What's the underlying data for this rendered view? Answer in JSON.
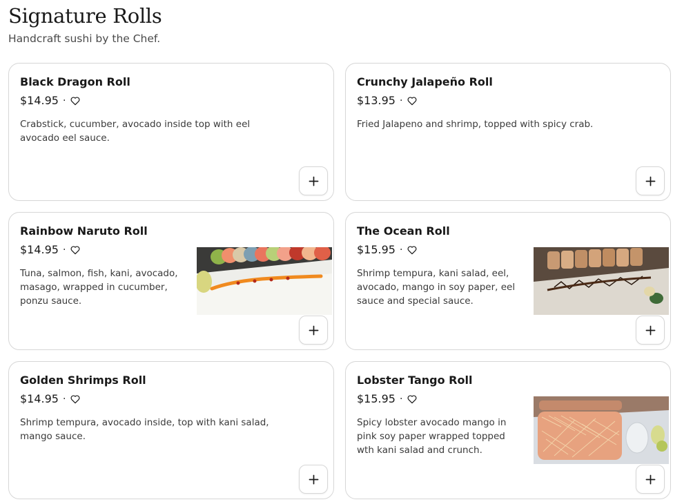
{
  "section": {
    "title": "Signature Rolls",
    "subtitle": "Handcraft sushi by the Chef."
  },
  "items": [
    {
      "name": "Black Dragon Roll",
      "price": "$14.95",
      "description": "Crabstick, cucumber, avocado inside top with eel avocado eel sauce.",
      "has_image": false
    },
    {
      "name": "Crunchy Jalapeño Roll",
      "price": "$13.95",
      "description": "Fried Jalapeno and shrimp, topped with spicy crab.",
      "has_image": false
    },
    {
      "name": "Rainbow Naruto Roll",
      "price": "$14.95",
      "description": "Tuna, salmon, fish, kani, avocado, masago, wrapped in cucumber, ponzu sauce.",
      "has_image": true
    },
    {
      "name": "The Ocean Roll",
      "price": "$15.95",
      "description": "Shrimp tempura, kani salad, eel, avocado, mango in soy paper, eel sauce and special sauce.",
      "has_image": true
    },
    {
      "name": "Golden Shrimps Roll",
      "price": "$14.95",
      "description": "Shrimp tempura, avocado inside, top with kani salad, mango sauce.",
      "has_image": false
    },
    {
      "name": "Lobster Tango Roll",
      "price": "$15.95",
      "description": "Spicy lobster avocado mango in pink soy paper wrapped topped wth kani salad and crunch.",
      "has_image": true
    }
  ],
  "separator": "·",
  "icons": {
    "favorite": "heart-outline-icon",
    "add": "plus-icon"
  }
}
